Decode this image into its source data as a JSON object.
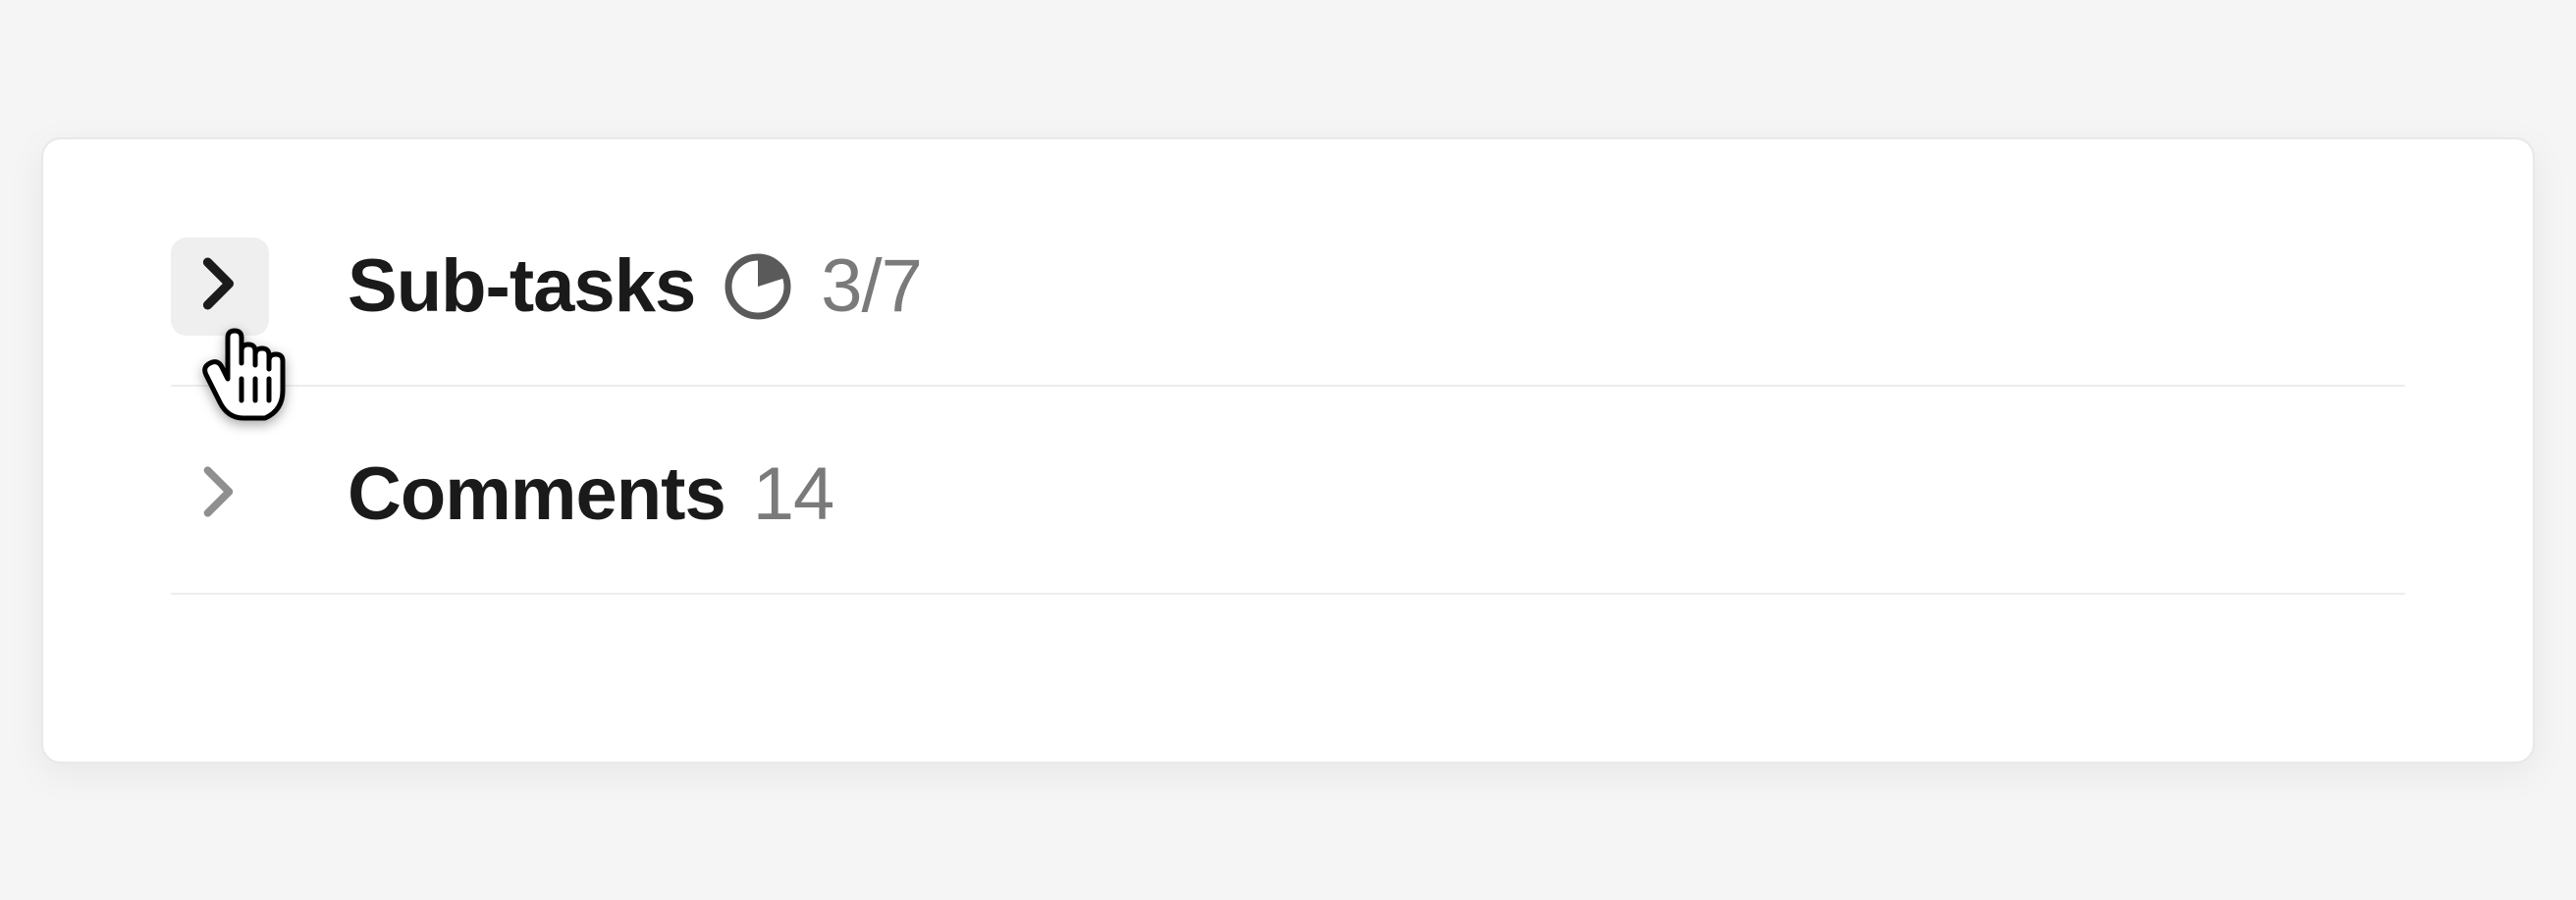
{
  "sections": {
    "subtasks": {
      "label": "Sub-tasks",
      "count": "3/7",
      "progress_fraction": 0.43
    },
    "comments": {
      "label": "Comments",
      "count": "14"
    }
  }
}
